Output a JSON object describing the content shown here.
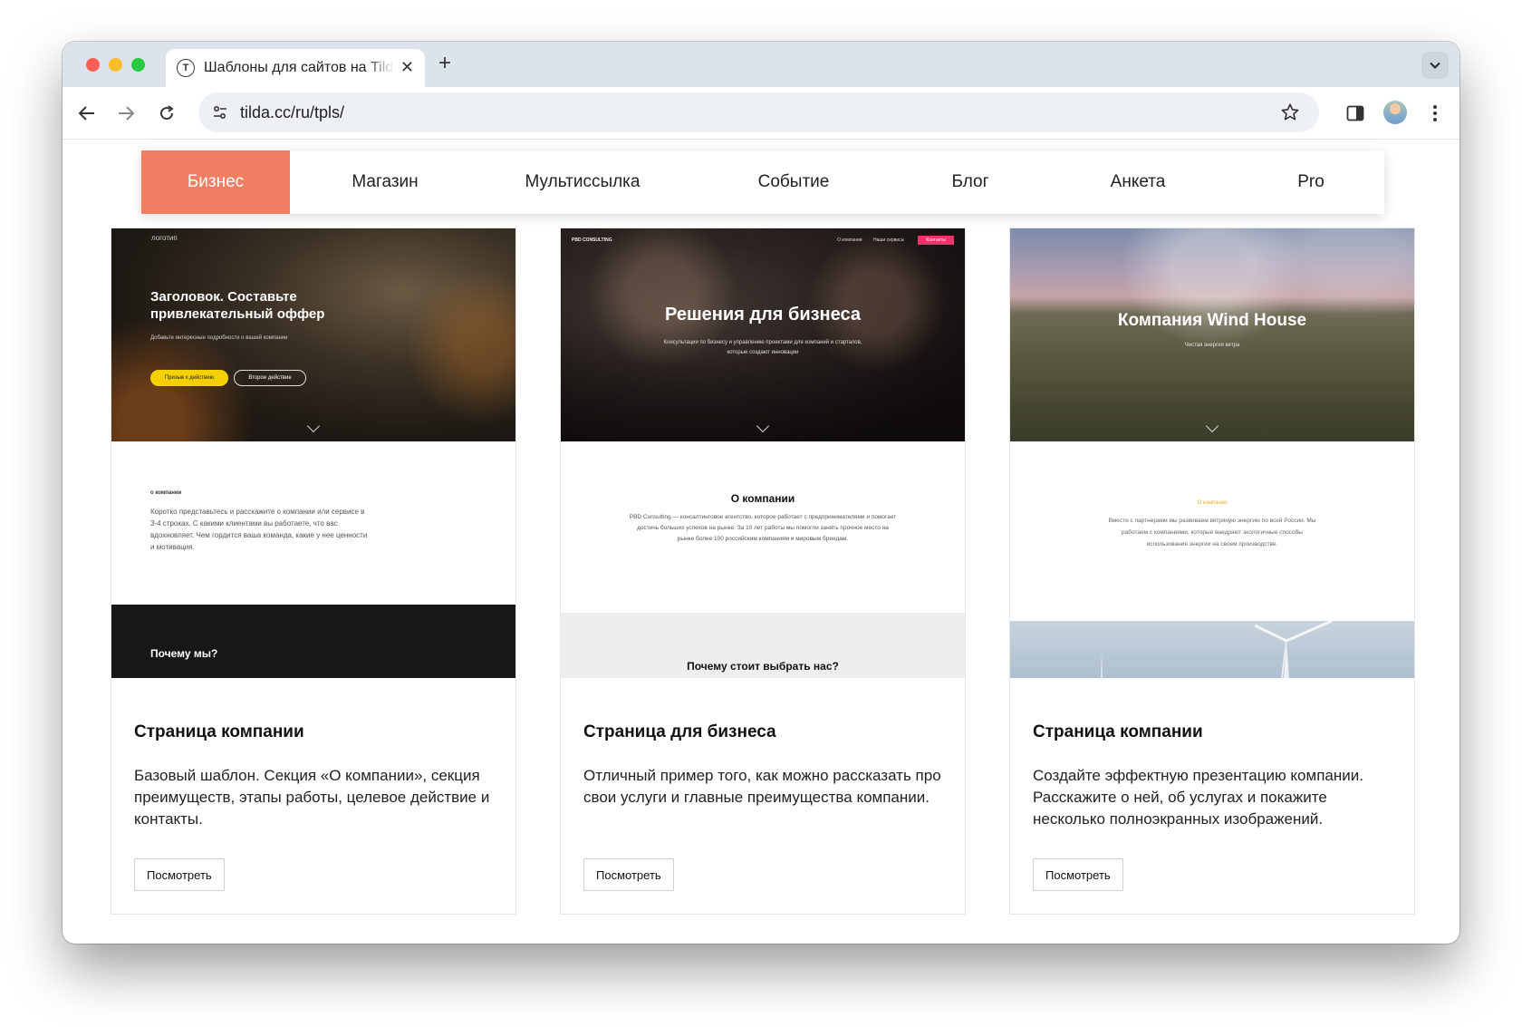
{
  "browser": {
    "tab_title": "Шаблоны для сайтов на Tilda",
    "tab_favicon": "T",
    "url": "tilda.cc/ru/tpls/"
  },
  "categories": {
    "items": [
      "Бизнес",
      "Магазин",
      "Мультиссылка",
      "Событие",
      "Блог",
      "Анкета",
      "Pro"
    ],
    "active_index": 0,
    "accent_color": "#f07e63"
  },
  "cards": [
    {
      "preview": {
        "logo": "логотип",
        "headline": "Заголовок. Составьте привлекательный оффер",
        "subline": "Добавьте интересные подробности о вашей компании",
        "button_primary": "Призыв к действию",
        "button_secondary": "Второе действие",
        "section_label": "о компании",
        "section_text": "Коротко представьтесь и расскажите о компании или сервисе в 3-4 строках. С какими клиентами вы работаете, что вас вдохновляет. Чем гордится ваша команда, какие у нее ценности и мотивация.",
        "bottom_heading": "Почему мы?"
      },
      "title": "Страница компании",
      "description": "Базовый шаблон. Секция «О компании», секция преимуществ, этапы работы, целевое действие и контакты.",
      "button": "Посмотреть"
    },
    {
      "preview": {
        "logo": "PBD CONSULTING",
        "nav_1": "О компании",
        "nav_2": "Наши сервисы",
        "nav_button": "Контакты",
        "headline": "Решения для бизнеса",
        "subline": "Консультации по бизнесу и управлению проектами для компаний и стартапов, которые создают инновации",
        "section_title": "О компании",
        "section_text": "PBD Consulting — консалтинговое агентство, которое работает с предпринимателями и помогает достичь больших успехов на рынке. За 10 лет работы мы помогли занять прочное место на рынке более 100 российским компаниям и мировым брендам.",
        "bottom_heading": "Почему стоит выбрать нас?"
      },
      "title": "Страница для бизнеса",
      "description": "Отличный пример того, как можно рассказать про свои услуги и главные преимущества компании.",
      "button": "Посмотреть"
    },
    {
      "preview": {
        "headline": "Компания Wind House",
        "subline": "Чистая энергия ветра",
        "section_label": "О компании",
        "section_text": "Вместе с партнерами мы развиваем ветряную энергию по всей России. Мы работаем с компаниями, которые внедряют экологичные способы использования энергии на своем производстве."
      },
      "title": "Страница компании",
      "description": "Создайте эффектную презентацию компании. Расскажите о ней, об услугах и покажите несколько полноэкранных изображений.",
      "button": "Посмотреть"
    }
  ]
}
